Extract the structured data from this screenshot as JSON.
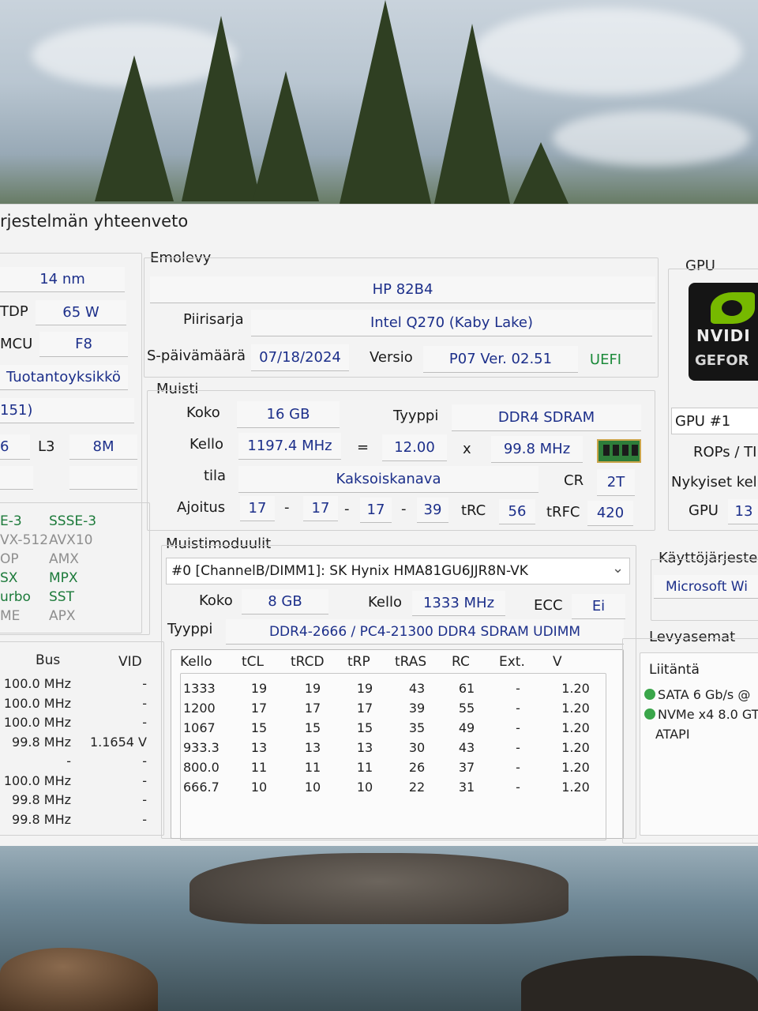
{
  "window": {
    "title": "rjestelmän yhteenveto"
  },
  "cpu_panel": {
    "process": "14 nm",
    "tdp_label": "TDP",
    "tdp_value": "65 W",
    "mcu_label": "MCU",
    "mcu_value": "F8",
    "production_unit": "Tuotantoyksikkö",
    "stepping_value": "151)",
    "l2_value": "6",
    "l3_label": "L3",
    "l3_value": "8M",
    "features": [
      {
        "label": "E-3",
        "enabled": true
      },
      {
        "label": "SSSE-3",
        "enabled": true
      },
      {
        "label": "VX-512",
        "enabled": false
      },
      {
        "label": "AVX10",
        "enabled": false
      },
      {
        "label": "OP",
        "enabled": false
      },
      {
        "label": "AMX",
        "enabled": false
      },
      {
        "label": "SX",
        "enabled": true
      },
      {
        "label": "MPX",
        "enabled": true
      },
      {
        "label": "urbo",
        "enabled": true
      },
      {
        "label": "SST",
        "enabled": true
      },
      {
        "label": "ME",
        "enabled": false
      },
      {
        "label": "APX",
        "enabled": false
      }
    ],
    "clock_table": {
      "headers": [
        "Bus",
        "VID"
      ],
      "rows": [
        {
          "bus": "100.0 MHz",
          "vid": "-"
        },
        {
          "bus": "100.0 MHz",
          "vid": "-"
        },
        {
          "bus": "100.0 MHz",
          "vid": "-"
        },
        {
          "bus": "99.8 MHz",
          "vid": "1.1654 V"
        },
        {
          "bus": "-",
          "vid": "-"
        },
        {
          "bus": "100.0 MHz",
          "vid": "-"
        },
        {
          "bus": "99.8 MHz",
          "vid": "-"
        },
        {
          "bus": "99.8 MHz",
          "vid": "-"
        }
      ]
    }
  },
  "motherboard": {
    "group_label": "Emolevy",
    "model": "HP 82B4",
    "chipset_label": "Piirisarja",
    "chipset_value": "Intel Q270 (Kaby Lake)",
    "bios_date_label": "S-päivämäärä",
    "bios_date_value": "07/18/2024",
    "version_label": "Versio",
    "version_value": "P07 Ver. 02.51",
    "uefi": "UEFI"
  },
  "memory": {
    "group_label": "Muisti",
    "size_label": "Koko",
    "size_value": "16 GB",
    "type_label": "Tyyppi",
    "type_value": "DDR4 SDRAM",
    "clock_label": "Kello",
    "clock_value": "1197.4 MHz",
    "equals": "=",
    "multiplier": "12.00",
    "times": "x",
    "base_clock": "99.8 MHz",
    "mode_label": "tila",
    "mode_value": "Kaksoiskanava",
    "cr_label": "CR",
    "cr_value": "2T",
    "timing_label": "Ajoitus",
    "timings": [
      "17",
      "17",
      "17",
      "39"
    ],
    "dash": "-",
    "trc_label": "tRC",
    "trc_value": "56",
    "trfc_label": "tRFC",
    "trfc_value": "420"
  },
  "modules": {
    "group_label": "Muistimoduulit",
    "selected": "#0 [ChannelB/DIMM1]: SK Hynix HMA81GU6JJR8N-VK",
    "dropdown_arrow": "⌄",
    "size_label": "Koko",
    "size_value": "8 GB",
    "clock_label": "Kello",
    "clock_value": "1333 MHz",
    "ecc_label": "ECC",
    "ecc_value": "Ei",
    "type_label": "Tyyppi",
    "type_value": "DDR4-2666 / PC4-21300 DDR4 SDRAM UDIMM",
    "spd_table": {
      "headers": [
        "Kello",
        "tCL",
        "tRCD",
        "tRP",
        "tRAS",
        "RC",
        "Ext.",
        "V"
      ],
      "rows": [
        [
          "1333",
          "19",
          "19",
          "19",
          "43",
          "61",
          "-",
          "1.20"
        ],
        [
          "1200",
          "17",
          "17",
          "17",
          "39",
          "55",
          "-",
          "1.20"
        ],
        [
          "1067",
          "15",
          "15",
          "15",
          "35",
          "49",
          "-",
          "1.20"
        ],
        [
          "933.3",
          "13",
          "13",
          "13",
          "30",
          "43",
          "-",
          "1.20"
        ],
        [
          "800.0",
          "11",
          "11",
          "11",
          "26",
          "37",
          "-",
          "1.20"
        ],
        [
          "666.7",
          "10",
          "10",
          "10",
          "22",
          "31",
          "-",
          "1.20"
        ]
      ]
    }
  },
  "gpu": {
    "group_label": "GPU",
    "logo_text": "NVIDI",
    "logo_sub": "GEFOR",
    "gpu_select": "GPU #1",
    "rops_label": "ROPs / TI",
    "clocks_label": "Nykyiset kello",
    "gpu_clock_label": "GPU",
    "gpu_clock_value": "13"
  },
  "os": {
    "group_label": "Käyttöjärjestel",
    "value": "Microsoft Wi"
  },
  "drives": {
    "group_label": "Levyasemat",
    "interface_label": "Liitäntä",
    "items": [
      {
        "text": "SATA 6 Gb/s @",
        "ok": true
      },
      {
        "text": "NVMe x4 8.0 GT",
        "ok": true
      },
      {
        "text": "ATAPI",
        "ok": false
      }
    ]
  }
}
